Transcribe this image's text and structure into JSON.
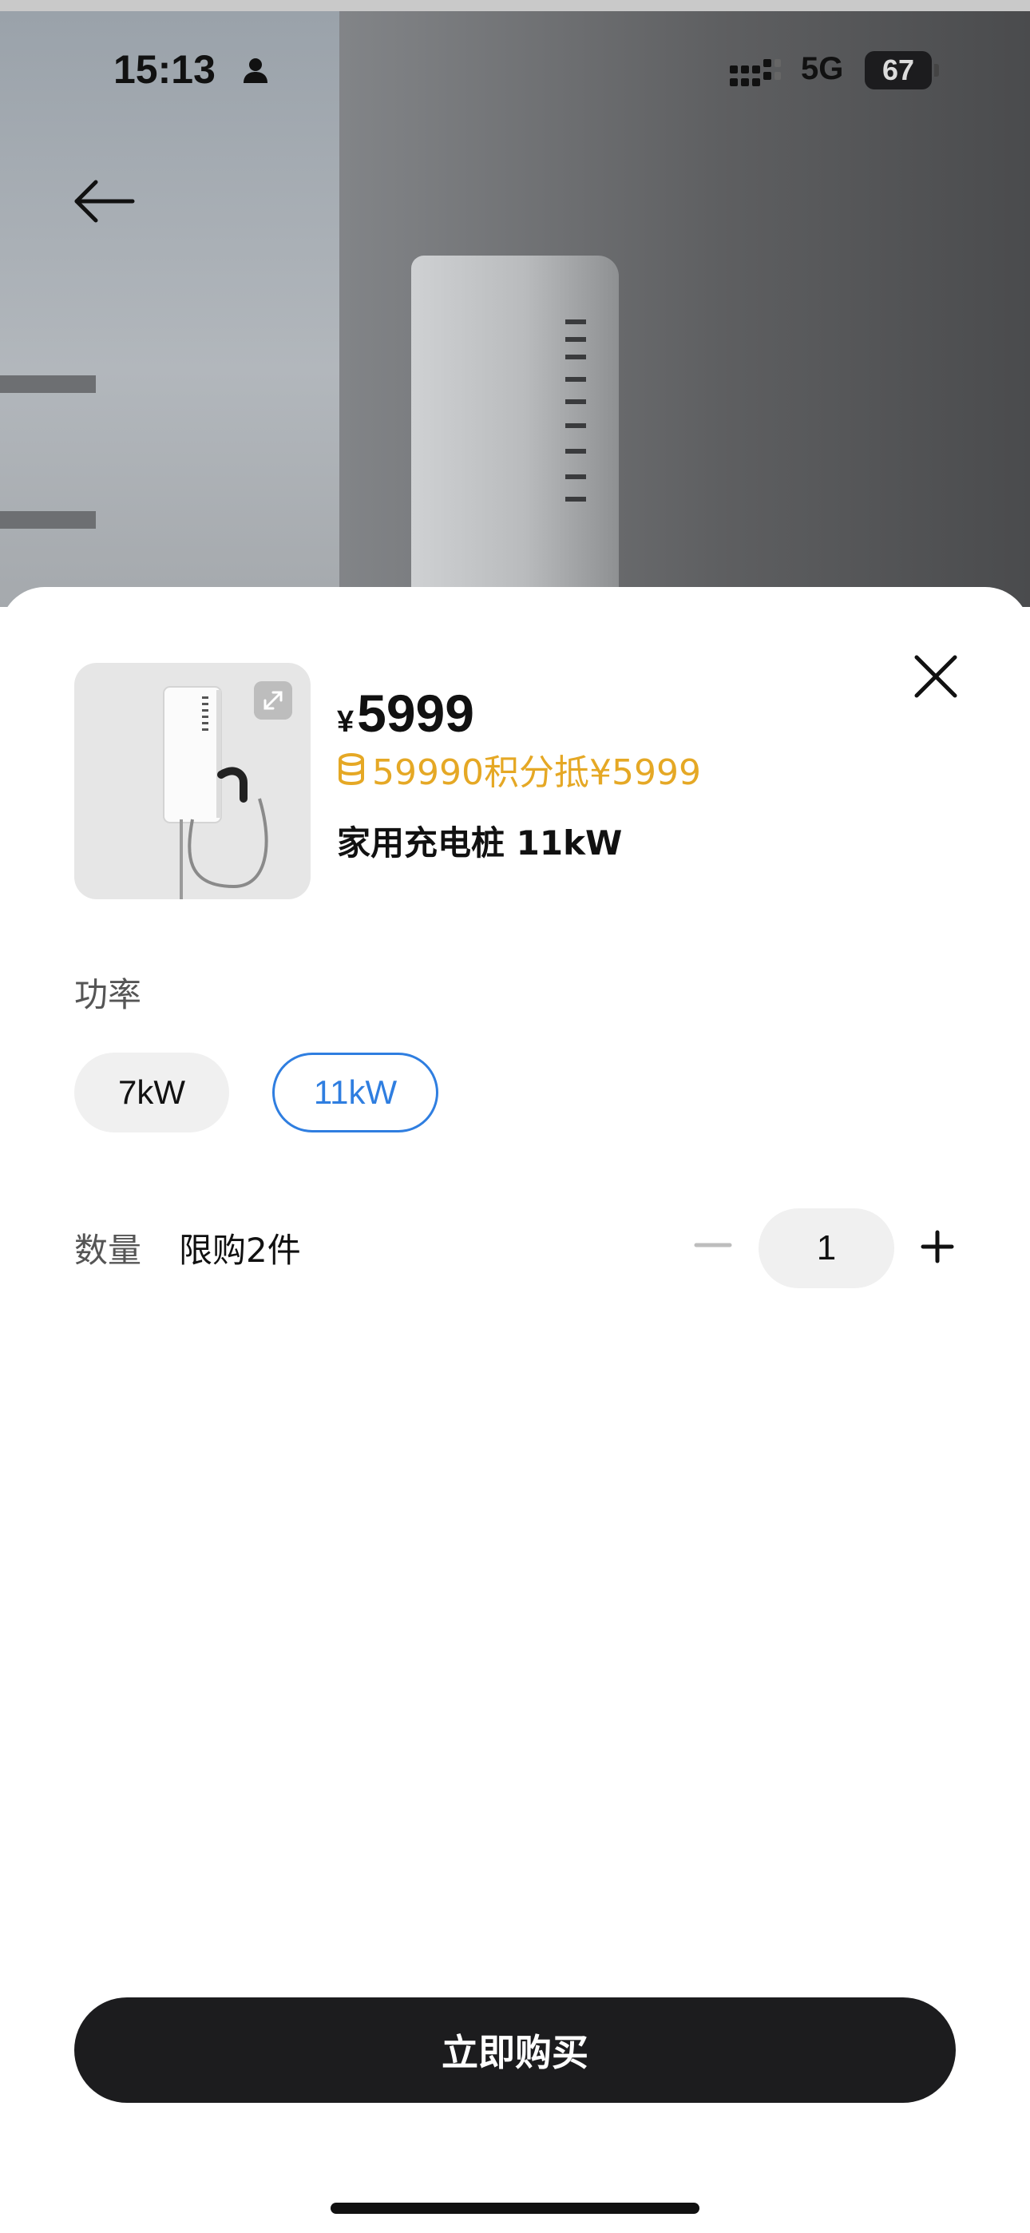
{
  "status_bar": {
    "time": "15:13",
    "network": "5G",
    "battery": "67"
  },
  "product": {
    "currency": "¥",
    "price": "5999",
    "points_text": "59990积分抵¥5999",
    "name": "家用充电桩 11kW"
  },
  "power": {
    "label": "功率",
    "options": [
      "7kW",
      "11kW"
    ],
    "selected": "11kW"
  },
  "quantity": {
    "label": "数量",
    "limit": "限购2件",
    "value": "1"
  },
  "buy_button": {
    "label": "立即购买"
  },
  "colors": {
    "accent_blue": "#2f7ee0",
    "points_gold": "#e5a825",
    "button_dark": "#1c1c1e"
  },
  "icons": [
    "person-icon",
    "signal-icon",
    "back-arrow-icon",
    "expand-icon",
    "close-icon",
    "coin-icon",
    "minus-icon",
    "plus-icon"
  ]
}
